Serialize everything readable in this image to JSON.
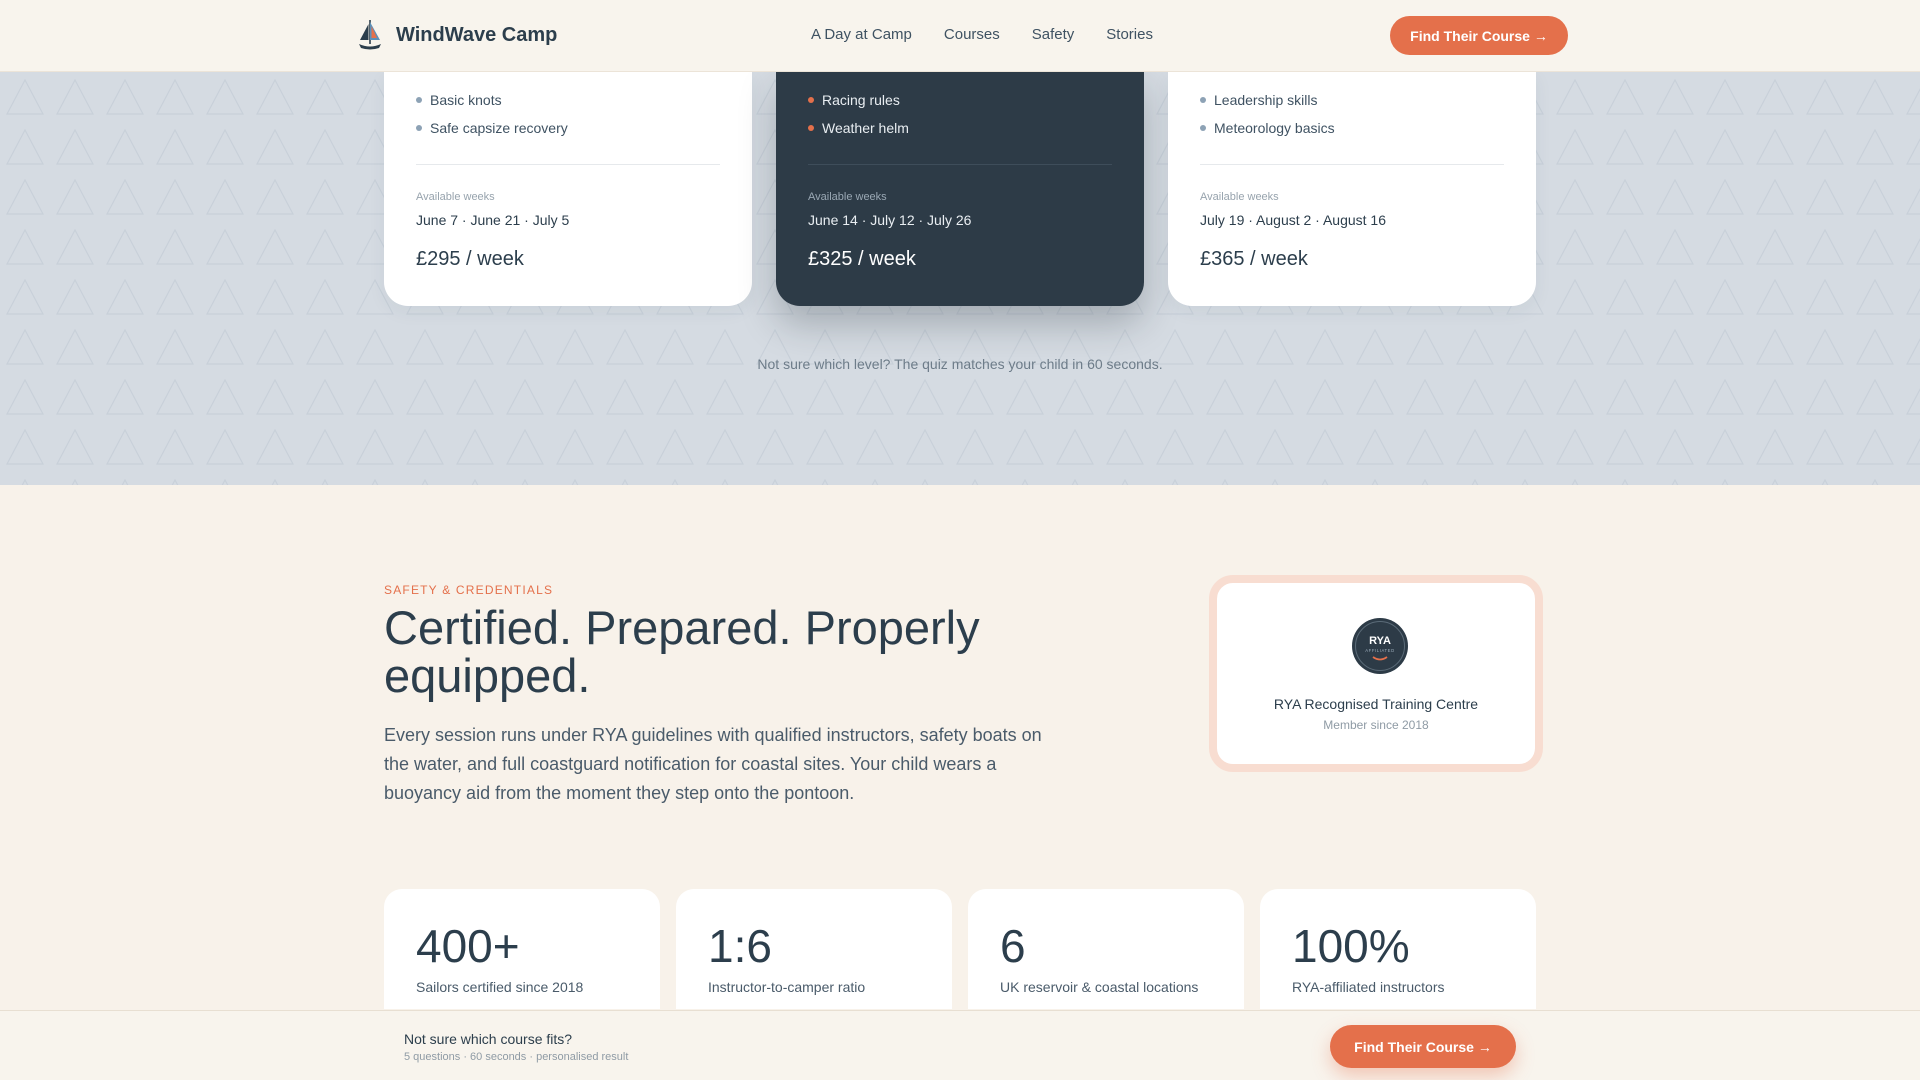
{
  "nav": {
    "brand": "WindWave Camp",
    "links": [
      "A Day at Camp",
      "Courses",
      "Safety",
      "Stories"
    ],
    "cta": "Find Their Course →"
  },
  "courses": [
    {
      "skills": [
        "Basic knots",
        "Safe capsize recovery"
      ],
      "weeks_label": "Available weeks",
      "weeks": "June 7 · June 21 · July 5",
      "price": "£295 / week",
      "highlighted": false
    },
    {
      "skills": [
        "Racing rules",
        "Weather helm"
      ],
      "weeks_label": "Available weeks",
      "weeks": "June 14 · July 12 · July 26",
      "price": "£325 / week",
      "highlighted": true
    },
    {
      "skills": [
        "Leadership skills",
        "Meteorology basics"
      ],
      "weeks_label": "Available weeks",
      "weeks": "July 19 · August 2 · August 16",
      "price": "£365 / week",
      "highlighted": false
    }
  ],
  "quiz_hint": "Not sure which level? The quiz matches your child in 60 seconds.",
  "safety": {
    "eyebrow": "SAFETY & CREDENTIALS",
    "title": "Certified. Prepared. Properly equipped.",
    "body": "Every session runs under RYA guidelines with qualified instructors, safety boats on the water, and full coastguard notification for coastal sites. Your child wears a buoyancy aid from the moment they step onto the pontoon."
  },
  "badge": {
    "seal_text": "RYA",
    "seal_subtext": "AFFILIATED",
    "title": "RYA Recognised Training Centre",
    "subtitle": "Member since 2018"
  },
  "stats": [
    {
      "value": "400+",
      "label": "Sailors certified since 2018"
    },
    {
      "value": "1:6",
      "label": "Instructor-to-camper ratio"
    },
    {
      "value": "6",
      "label": "UK reservoir & coastal locations"
    },
    {
      "value": "100%",
      "label": "RYA-affiliated instructors"
    }
  ],
  "sticky": {
    "question": "Not sure which course fits?",
    "meta": "5 questions · 60 seconds · personalised result",
    "cta": "Find Their Course →"
  },
  "colors": {
    "accent": "#e4704b",
    "navy": "#2d3b47",
    "cream": "#f8f2ea",
    "band": "#d5dbe2"
  }
}
